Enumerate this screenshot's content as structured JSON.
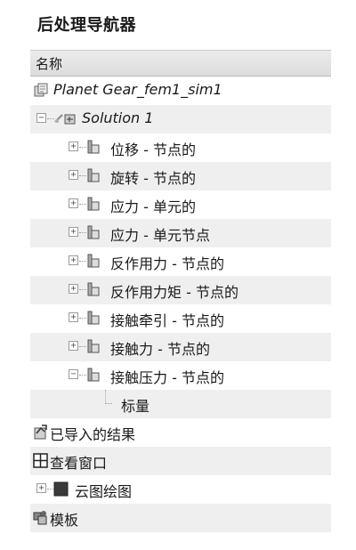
{
  "navigator": {
    "title": "后处理导航器",
    "column_header": "名称",
    "model": "Planet Gear_fem1_sim1",
    "solution": "Solution 1",
    "results": [
      {
        "label": "位移 - 节点的",
        "expander": "+"
      },
      {
        "label": "旋转 - 节点的",
        "expander": "+"
      },
      {
        "label": "应力 - 单元的",
        "expander": "+"
      },
      {
        "label": "应力 - 单元节点",
        "expander": "+"
      },
      {
        "label": "反作用力 - 节点的",
        "expander": "+"
      },
      {
        "label": "反作用力矩 - 节点的",
        "expander": "+"
      },
      {
        "label": "接触牵引 - 节点的",
        "expander": "+"
      },
      {
        "label": "接触力 - 节点的",
        "expander": "+"
      },
      {
        "label": "接触压力 - 节点的",
        "expander": "−"
      }
    ],
    "scalar": "标量",
    "imported_results": "已导入的结果",
    "viewports": "查看窗口",
    "contour_plot": "云图绘图",
    "templates": "模板"
  }
}
